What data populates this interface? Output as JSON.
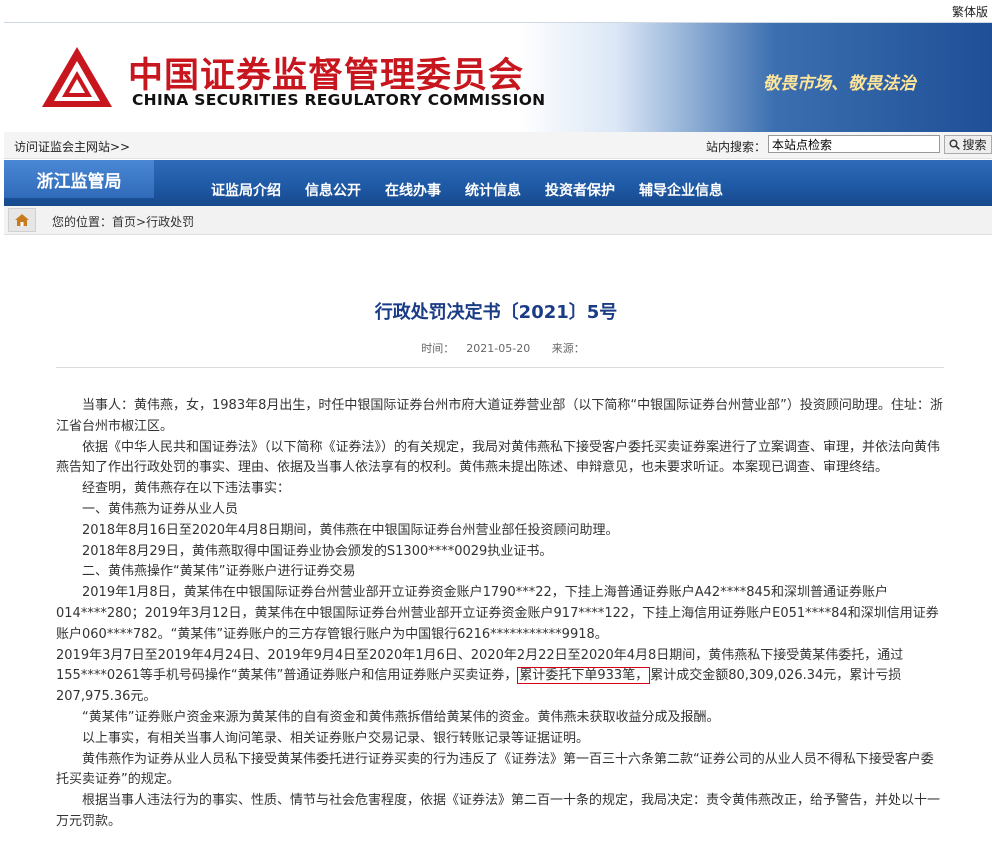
{
  "lang_switch": "繁体版",
  "header": {
    "title_cn": "中国证券监督管理委员会",
    "title_en": "CHINA SECURITIES REGULATORY COMMISSION",
    "slogan": "敬畏市场、敬畏法治"
  },
  "subbar": {
    "visit_link": "访问证监会主网站>>",
    "search_label": "站内搜索：",
    "search_value": "本站点检索",
    "search_button": "搜索"
  },
  "nav": {
    "bureau": "浙江监管局",
    "items": [
      "证监局介绍",
      "信息公开",
      "在线办事",
      "统计信息",
      "投资者保护",
      "辅导企业信息"
    ]
  },
  "breadcrumb": {
    "prefix": "您的位置：",
    "home": "首页",
    "sep": ">",
    "current": "行政处罚"
  },
  "article": {
    "title": "行政处罚决定书〔2021〕5号",
    "time_label": "时间：",
    "time": "2021-05-20",
    "source_label": "来源：",
    "paragraphs": {
      "p1": "当事人：黄伟燕，女，1983年8月出生，时任中银国际证券台州市府大道证券营业部（以下简称“中银国际证券台州营业部”）投资顾问助理。住址：浙江省台州市椒江区。",
      "p2": "依据《中华人民共和国证券法》（以下简称《证券法》）的有关规定，我局对黄伟燕私下接受客户委托买卖证券案进行了立案调查、审理，并依法向黄伟燕告知了作出行政处罚的事实、理由、依据及当事人依法享有的权利。黄伟燕未提出陈述、申辩意见，也未要求听证。本案现已调查、审理终结。",
      "p3": "经查明，黄伟燕存在以下违法事实：",
      "p4": "一、黄伟燕为证券从业人员",
      "p5": "2018年8月16日至2020年4月8日期间，黄伟燕在中银国际证券台州营业部任投资顾问助理。",
      "p6": "2018年8月29日，黄伟燕取得中国证券业协会颁发的S1300****0029执业证书。",
      "p7": "二、黄伟燕操作“黄某伟”证券账户进行证券交易",
      "p8": "2019年1月8日，黄某伟在中银国际证券台州营业部开立证券资金账户1790***22，下挂上海普通证券账户A42****845和深圳普通证券账户014****280；2019年3月12日，黄某伟在中银国际证券台州营业部开立证券资金账户917****122，下挂上海信用证券账户E051****84和深圳信用证券账户060****782。“黄某伟”证券账户的三方存管银行账户为中国银行6216***********9918。",
      "p9_a": "2019年3月7日至2019年4月24日、2019年9月4日至2020年1月6日、2020年2月22日至2020年4月8日期间，黄伟燕私下接受黄某伟委托，通过155****0261等手机号码操作“黄某伟”普通证券账户和信用证券账户买卖证券，",
      "p9_hl": "累计委托下单933笔，",
      "p9_b": "累计成交金额80,309,026.34元，累计亏损207,975.36元。",
      "p10": "“黄某伟”证券账户资金来源为黄某伟的自有资金和黄伟燕拆借给黄某伟的资金。黄伟燕未获取收益分成及报酬。",
      "p11": "以上事实，有相关当事人询问笔录、相关证券账户交易记录、银行转账记录等证据证明。",
      "p12": "黄伟燕作为证券从业人员私下接受黄某伟委托进行证券买卖的行为违反了《证券法》第一百三十六条第二款“证券公司的从业人员不得私下接受客户委托买卖证券”的规定。",
      "p13": "根据当事人违法行为的事实、性质、情节与社会危害程度，依据《证券法》第二百一十条的规定，我局决定：责令黄伟燕改正，给予警告，并处以十一万元罚款。"
    }
  },
  "colors": {
    "brand_red": "#c8161e",
    "nav_blue": "#1f5aa6",
    "title_blue": "#1a3b85",
    "highlight_border": "#d9001b"
  }
}
